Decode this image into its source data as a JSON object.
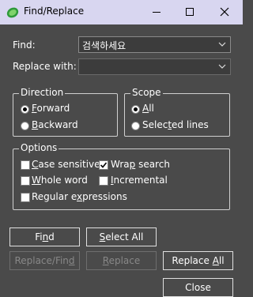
{
  "window": {
    "title": "Find/Replace"
  },
  "find": {
    "label": "Find:",
    "value": "검색하세요"
  },
  "replace": {
    "label": "Replace with:",
    "value": ""
  },
  "direction": {
    "title": "Direction",
    "forward": "Forward",
    "backward": "Backward",
    "selected": "forward"
  },
  "scope": {
    "title": "Scope",
    "all": "All",
    "selected_lines": "Selected lines",
    "selected": "all"
  },
  "options": {
    "title": "Options",
    "case_sensitive": {
      "label": "Case sensitive",
      "checked": false
    },
    "wrap_search": {
      "label": "Wrap search",
      "checked": true
    },
    "whole_word": {
      "label": "Whole word",
      "checked": false
    },
    "incremental": {
      "label": "Incremental",
      "checked": false
    },
    "regular_expressions": {
      "label": "Regular expressions",
      "checked": false
    }
  },
  "buttons": {
    "find": "Find",
    "select_all": "Select All",
    "replace_find": "Replace/Find",
    "replace": "Replace",
    "replace_all": "Replace All",
    "close": "Close"
  },
  "icons": {
    "app": "app-leaf-icon",
    "minimize": "minimize-icon",
    "maximize": "maximize-icon",
    "close": "close-icon",
    "dropdown": "chevron-down-icon",
    "check": "checkmark-icon"
  },
  "colors": {
    "background": "#4a4a4a",
    "titlebar": "#d8d6f0",
    "field": "#3c3c3c"
  }
}
